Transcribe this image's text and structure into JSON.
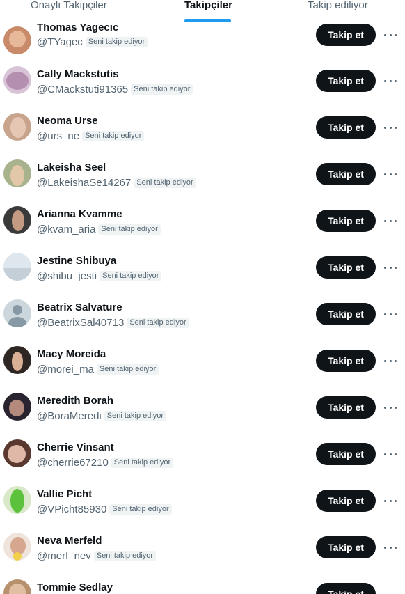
{
  "tabs": [
    {
      "label": "Onaylı Takipçiler",
      "active": false
    },
    {
      "label": "Takipçiler",
      "active": true
    },
    {
      "label": "Takip ediliyor",
      "active": false
    }
  ],
  "follows_you_label": "Seni takip ediyor",
  "follow_button_label": "Takip et",
  "colors": {
    "accent": "#1d9bf0",
    "button_bg": "#0f1419",
    "secondary_text": "#536471",
    "badge_bg": "#eff3f4"
  },
  "users": [
    {
      "name": "Thomas Yagecic",
      "handle": "@TYagec",
      "follows_you": true
    },
    {
      "name": "Cally Mackstutis",
      "handle": "@CMackstuti91365",
      "follows_you": true
    },
    {
      "name": "Neoma Urse",
      "handle": "@urs_ne",
      "follows_you": true
    },
    {
      "name": "Lakeisha Seel",
      "handle": "@LakeishaSe14267",
      "follows_you": true
    },
    {
      "name": "Arianna Kvamme",
      "handle": "@kvam_aria",
      "follows_you": true
    },
    {
      "name": "Jestine Shibuya",
      "handle": "@shibu_jesti",
      "follows_you": true
    },
    {
      "name": "Beatrix Salvature",
      "handle": "@BeatrixSal40713",
      "follows_you": true
    },
    {
      "name": "Macy Moreida",
      "handle": "@morei_ma",
      "follows_you": true
    },
    {
      "name": "Meredith Borah",
      "handle": "@BoraMeredi",
      "follows_you": true
    },
    {
      "name": "Cherrie Vinsant",
      "handle": "@cherrie67210",
      "follows_you": true
    },
    {
      "name": "Vallie Picht",
      "handle": "@VPicht85930",
      "follows_you": true
    },
    {
      "name": "Neva Merfeld",
      "handle": "@merf_nev",
      "follows_you": true
    },
    {
      "name": "Tommie Sedlay",
      "handle": "",
      "follows_you": false
    }
  ]
}
